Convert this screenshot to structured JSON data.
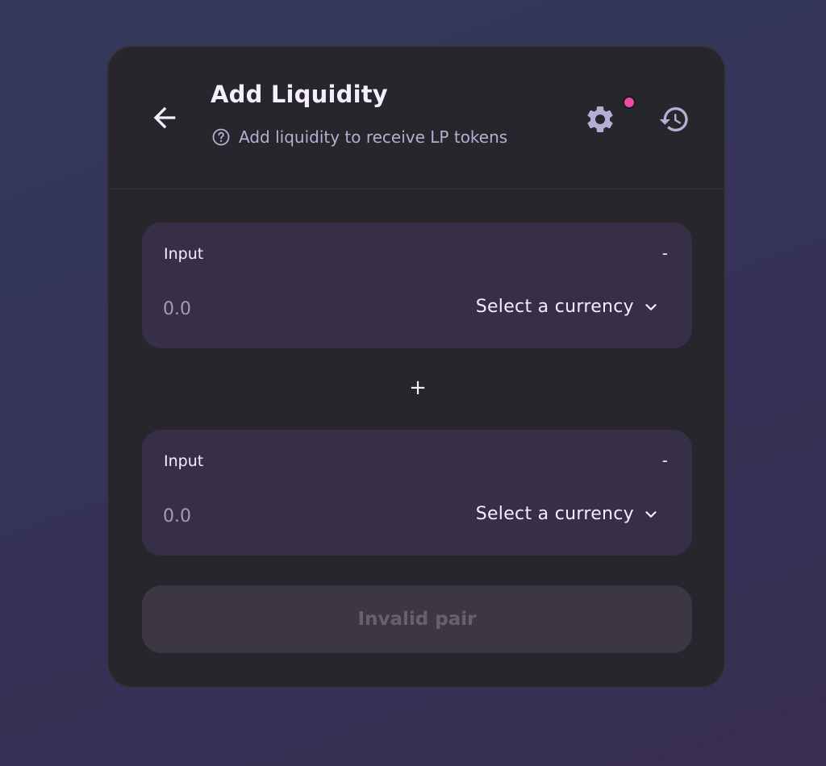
{
  "header": {
    "title": "Add Liquidity",
    "subtitle": "Add liquidity to receive LP tokens",
    "back_icon": "arrow-left-icon",
    "help_icon": "question-circle-icon",
    "settings_icon": "gear-icon",
    "history_icon": "history-icon",
    "notification_dot_color": "#ed4b9e"
  },
  "panels": [
    {
      "label": "Input",
      "balance": "-",
      "amount_placeholder": "0.0",
      "currency_label": "Select a currency",
      "chevron_icon": "chevron-down-icon"
    },
    {
      "label": "Input",
      "balance": "-",
      "amount_placeholder": "0.0",
      "currency_label": "Select a currency",
      "chevron_icon": "chevron-down-icon"
    }
  ],
  "separator": "+",
  "submit": {
    "label": "Invalid pair",
    "disabled": true
  },
  "colors": {
    "card_background": "#27262c",
    "panel_background": "#372f47",
    "text_primary": "#f4eeff",
    "text_secondary": "#b8add2",
    "accent_pink": "#ed4b9e",
    "disabled_button": "#3c3742"
  }
}
